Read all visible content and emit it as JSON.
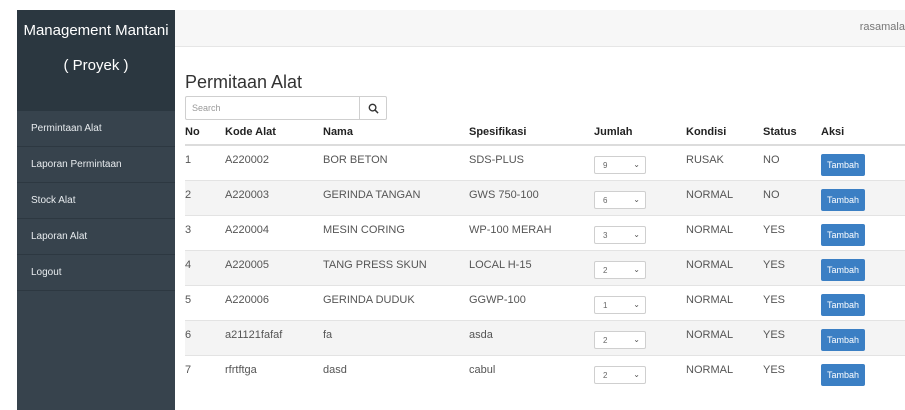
{
  "sidebar": {
    "brand_line1": "Management Mantani",
    "brand_line2": "( Proyek )",
    "items": [
      {
        "label": "Permintaan Alat"
      },
      {
        "label": "Laporan Permintaan"
      },
      {
        "label": "Stock Alat"
      },
      {
        "label": "Laporan Alat"
      },
      {
        "label": "Logout"
      }
    ]
  },
  "header": {
    "user": "rasamala"
  },
  "main": {
    "title": "Permitaan Alat",
    "search": {
      "placeholder": "Search",
      "value": ""
    },
    "columns": [
      "No",
      "Kode Alat",
      "Nama",
      "Spesifikasi",
      "Jumlah",
      "Kondisi",
      "Status",
      "Aksi"
    ],
    "action_label": "Tambah",
    "rows": [
      {
        "no": "1",
        "kode": "A220002",
        "nama": "BOR BETON",
        "spesifikasi": "SDS-PLUS",
        "jumlah": "9",
        "kondisi": "RUSAK",
        "status": "NO"
      },
      {
        "no": "2",
        "kode": "A220003",
        "nama": "GERINDA TANGAN",
        "spesifikasi": "GWS 750-100",
        "jumlah": "6",
        "kondisi": "NORMAL",
        "status": "NO"
      },
      {
        "no": "3",
        "kode": "A220004",
        "nama": "MESIN CORING",
        "spesifikasi": "WP-100 MERAH",
        "jumlah": "3",
        "kondisi": "NORMAL",
        "status": "YES"
      },
      {
        "no": "4",
        "kode": "A220005",
        "nama": "TANG PRESS SKUN",
        "spesifikasi": "LOCAL H-15",
        "jumlah": "2",
        "kondisi": "NORMAL",
        "status": "YES"
      },
      {
        "no": "5",
        "kode": "A220006",
        "nama": "GERINDA DUDUK",
        "spesifikasi": "GGWP-100",
        "jumlah": "1",
        "kondisi": "NORMAL",
        "status": "YES"
      },
      {
        "no": "6",
        "kode": "a21121fafaf",
        "nama": "fa",
        "spesifikasi": "asda",
        "jumlah": "2",
        "kondisi": "NORMAL",
        "status": "YES"
      },
      {
        "no": "7",
        "kode": "rfrtftga",
        "nama": "dasd",
        "spesifikasi": "cabul",
        "jumlah": "2",
        "kondisi": "NORMAL",
        "status": "YES"
      }
    ]
  },
  "icons": {
    "search": "search-icon",
    "select": "chevron-down-icon"
  },
  "colors": {
    "sidebar": "#37434d",
    "brand": "#2b3740",
    "button": "#3b7fc4"
  }
}
